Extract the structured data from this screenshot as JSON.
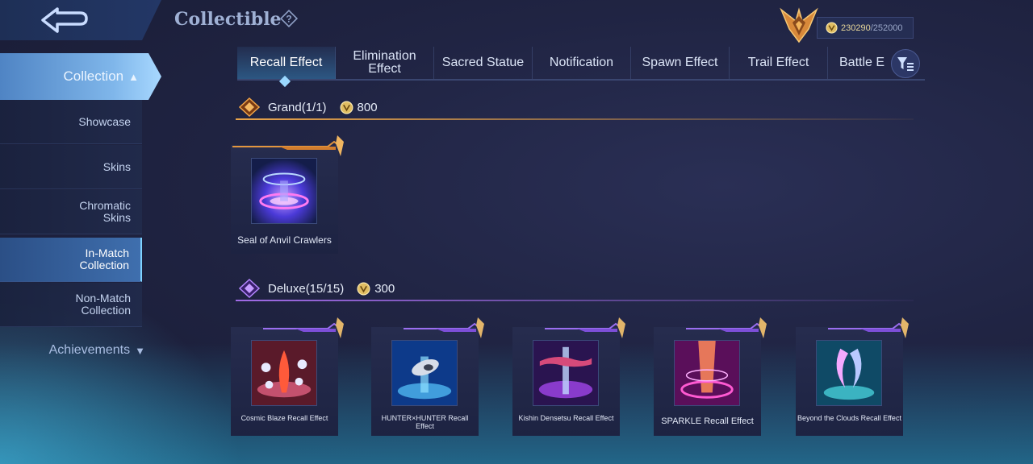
{
  "header": {
    "title": "Collectible",
    "points_current": "230290",
    "points_max": "/252000"
  },
  "sidebar": {
    "collection_label": "Collection",
    "items": [
      {
        "label": "Showcase",
        "active": false
      },
      {
        "label": "Skins",
        "active": false
      },
      {
        "label": "Chromatic Skins",
        "active": false
      },
      {
        "label": "In-Match Collection",
        "active": true
      },
      {
        "label": "Non-Match Collection",
        "active": false
      }
    ],
    "achievements_label": "Achievements"
  },
  "tabs": [
    {
      "label": "Recall Effect",
      "active": true
    },
    {
      "label": "Elimination Effect",
      "active": false
    },
    {
      "label": "Sacred Statue",
      "active": false
    },
    {
      "label": "Notification",
      "active": false
    },
    {
      "label": "Spawn Effect",
      "active": false
    },
    {
      "label": "Trail Effect",
      "active": false
    },
    {
      "label": "Battle E",
      "active": false
    }
  ],
  "sections": {
    "grand": {
      "title": "Grand(1/1)",
      "points": "800",
      "accent": "#e9a44a",
      "items": [
        {
          "name": "Seal of Anvil Crawlers"
        }
      ]
    },
    "deluxe": {
      "title": "Deluxe(15/15)",
      "points": "300",
      "accent": "#a06be6",
      "items": [
        {
          "name": "Cosmic Blaze Recall Effect"
        },
        {
          "name": "HUNTER×HUNTER Recall Effect"
        },
        {
          "name": "Kishin Densetsu Recall Effect"
        },
        {
          "name": "SPARKLE Recall Effect"
        },
        {
          "name": "Beyond the Clouds Recall Effect"
        }
      ]
    }
  },
  "icons": {
    "back": "back-arrow-icon",
    "help": "help-icon",
    "filter": "filter-icon",
    "coin": "coin-icon",
    "rank": "rank-emblem-icon"
  }
}
